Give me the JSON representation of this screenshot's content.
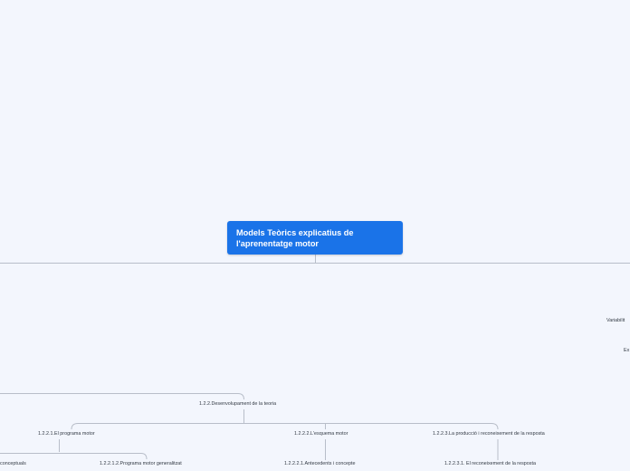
{
  "mindmap": {
    "root": "Models Teòrics explicatius de l'aprenentatge motor",
    "side_labels": {
      "variability": "Variabilit",
      "ex": "Ex"
    },
    "development": "1.2.2.Desenvolupament de la teoria",
    "motor_program": "1.2.2.1.El programa motor",
    "scheme": "1.2.2.2.L'esquema motor",
    "production": "1.2.2.3.La producció i reconeixement de la resposta",
    "conceptuals": "conceptuals",
    "generalized_program": "1.2.2.1.2.Programa motor generalitzat",
    "antecedents": "1.2.2.2.1.Antecedents i concepte",
    "recognition": "1.2.2.3.1. El reconeixement de la resposta"
  },
  "colors": {
    "background": "#f3f6fd",
    "root_fill": "#1a73e8",
    "root_text": "#ffffff",
    "connector": "#b8bec9",
    "topic_text": "#333a44"
  }
}
